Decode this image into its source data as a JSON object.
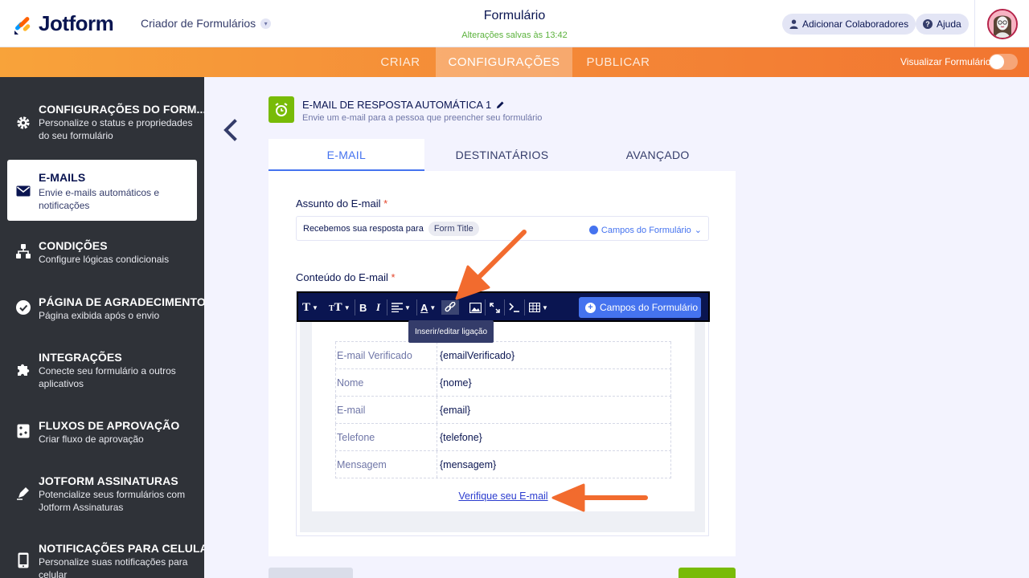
{
  "header": {
    "logo_text": "Jotform",
    "builder_label": "Criador de Formulários",
    "form_title": "Formulário",
    "save_status": "Alterações salvas às 13:42",
    "collab_button": "Adicionar Colaboradores",
    "help_button": "Ajuda"
  },
  "nav": {
    "tabs": [
      {
        "label": "CRIAR"
      },
      {
        "label": "CONFIGURAÇÕES"
      },
      {
        "label": "PUBLICAR"
      }
    ],
    "active_tab": "CONFIGURAÇÕES",
    "preview_label": "Visualizar Formulário",
    "preview_toggle_on": false
  },
  "sidebar": {
    "items": [
      {
        "title": "CONFIGURAÇÕES DO FORM...",
        "desc": "Personalize o status e propriedades do seu formulário",
        "icon": "gear-icon"
      },
      {
        "title": "E-MAILS",
        "desc": "Envie e-mails automáticos e notificações",
        "icon": "envelope-icon",
        "active": true
      },
      {
        "title": "CONDIÇÕES",
        "desc": "Configure lógicas condicionais",
        "icon": "hierarchy-icon"
      },
      {
        "title": "PÁGINA DE AGRADECIMENTO",
        "desc": "Página exibida após o envio",
        "icon": "check-circle-icon"
      },
      {
        "title": "INTEGRAÇÕES",
        "desc": "Conecte seu formulário a outros aplicativos",
        "icon": "puzzle-icon"
      },
      {
        "title": "FLUXOS DE APROVAÇÃO",
        "desc": "Criar fluxo de aprovação",
        "icon": "flow-icon"
      },
      {
        "title": "JOTFORM ASSINATURAS",
        "desc": "Potencialize seus formulários com Jotform Assinaturas",
        "icon": "pen-icon"
      },
      {
        "title": "NOTIFICAÇÕES PARA CELULAR",
        "desc": "Personalize suas notificações para celular",
        "icon": "phone-icon"
      }
    ]
  },
  "email_card": {
    "title": "E-MAIL DE RESPOSTA AUTOMÁTICA 1",
    "subtitle": "Envie um e-mail para a pessoa que preencher seu formulário",
    "tabs": [
      "E-MAIL",
      "DESTINATÁRIOS",
      "AVANÇADO"
    ],
    "active_tab": "E-MAIL",
    "subject_label": "Assunto do E-mail",
    "subject_text": "Recebemos sua resposta para",
    "subject_tag": "Form Title",
    "form_fields_link": "Campos do Formulário",
    "content_label": "Conteúdo do E-mail",
    "required_mark": "*",
    "toolbar_fields_button": "Campos do Formulário",
    "tooltip": "Inserir/editar ligação",
    "table_rows": [
      {
        "key": "E-mail Verificado",
        "value": "{emailVerificado}"
      },
      {
        "key": "Nome",
        "value": "{nome}"
      },
      {
        "key": "E-mail",
        "value": "{email}"
      },
      {
        "key": "Telefone",
        "value": "{telefone}"
      },
      {
        "key": "Mensagem",
        "value": "{mensagem}"
      }
    ],
    "verify_link": "Verifique seu E-mail"
  },
  "colors": {
    "accent": "#4573ef",
    "orange": "#f48a38",
    "sidebar_bg": "#2f3238",
    "annotation_arrow": "#f26b2e"
  }
}
